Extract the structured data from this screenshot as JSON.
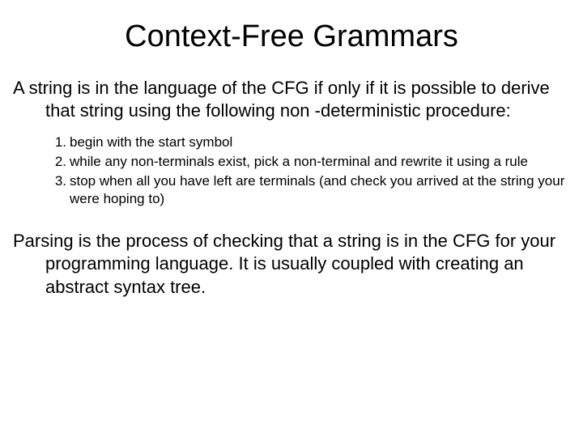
{
  "title": "Context-Free Grammars",
  "para1": "A string is in the language of the CFG if only if it is possible to derive that string using the following non -deterministic procedure:",
  "list": {
    "item1_num": "1.",
    "item1": "begin with the start symbol",
    "item2_num": "2.",
    "item2": "while any non-terminals exist, pick a non-terminal and rewrite it using a rule",
    "item3_num": "3.",
    "item3": "stop when all you have left are terminals (and check you arrived at the string your were hoping to)"
  },
  "para2": "Parsing is the process of checking that a string is in the CFG for your programming language.  It is usually coupled with creating an abstract syntax tree."
}
